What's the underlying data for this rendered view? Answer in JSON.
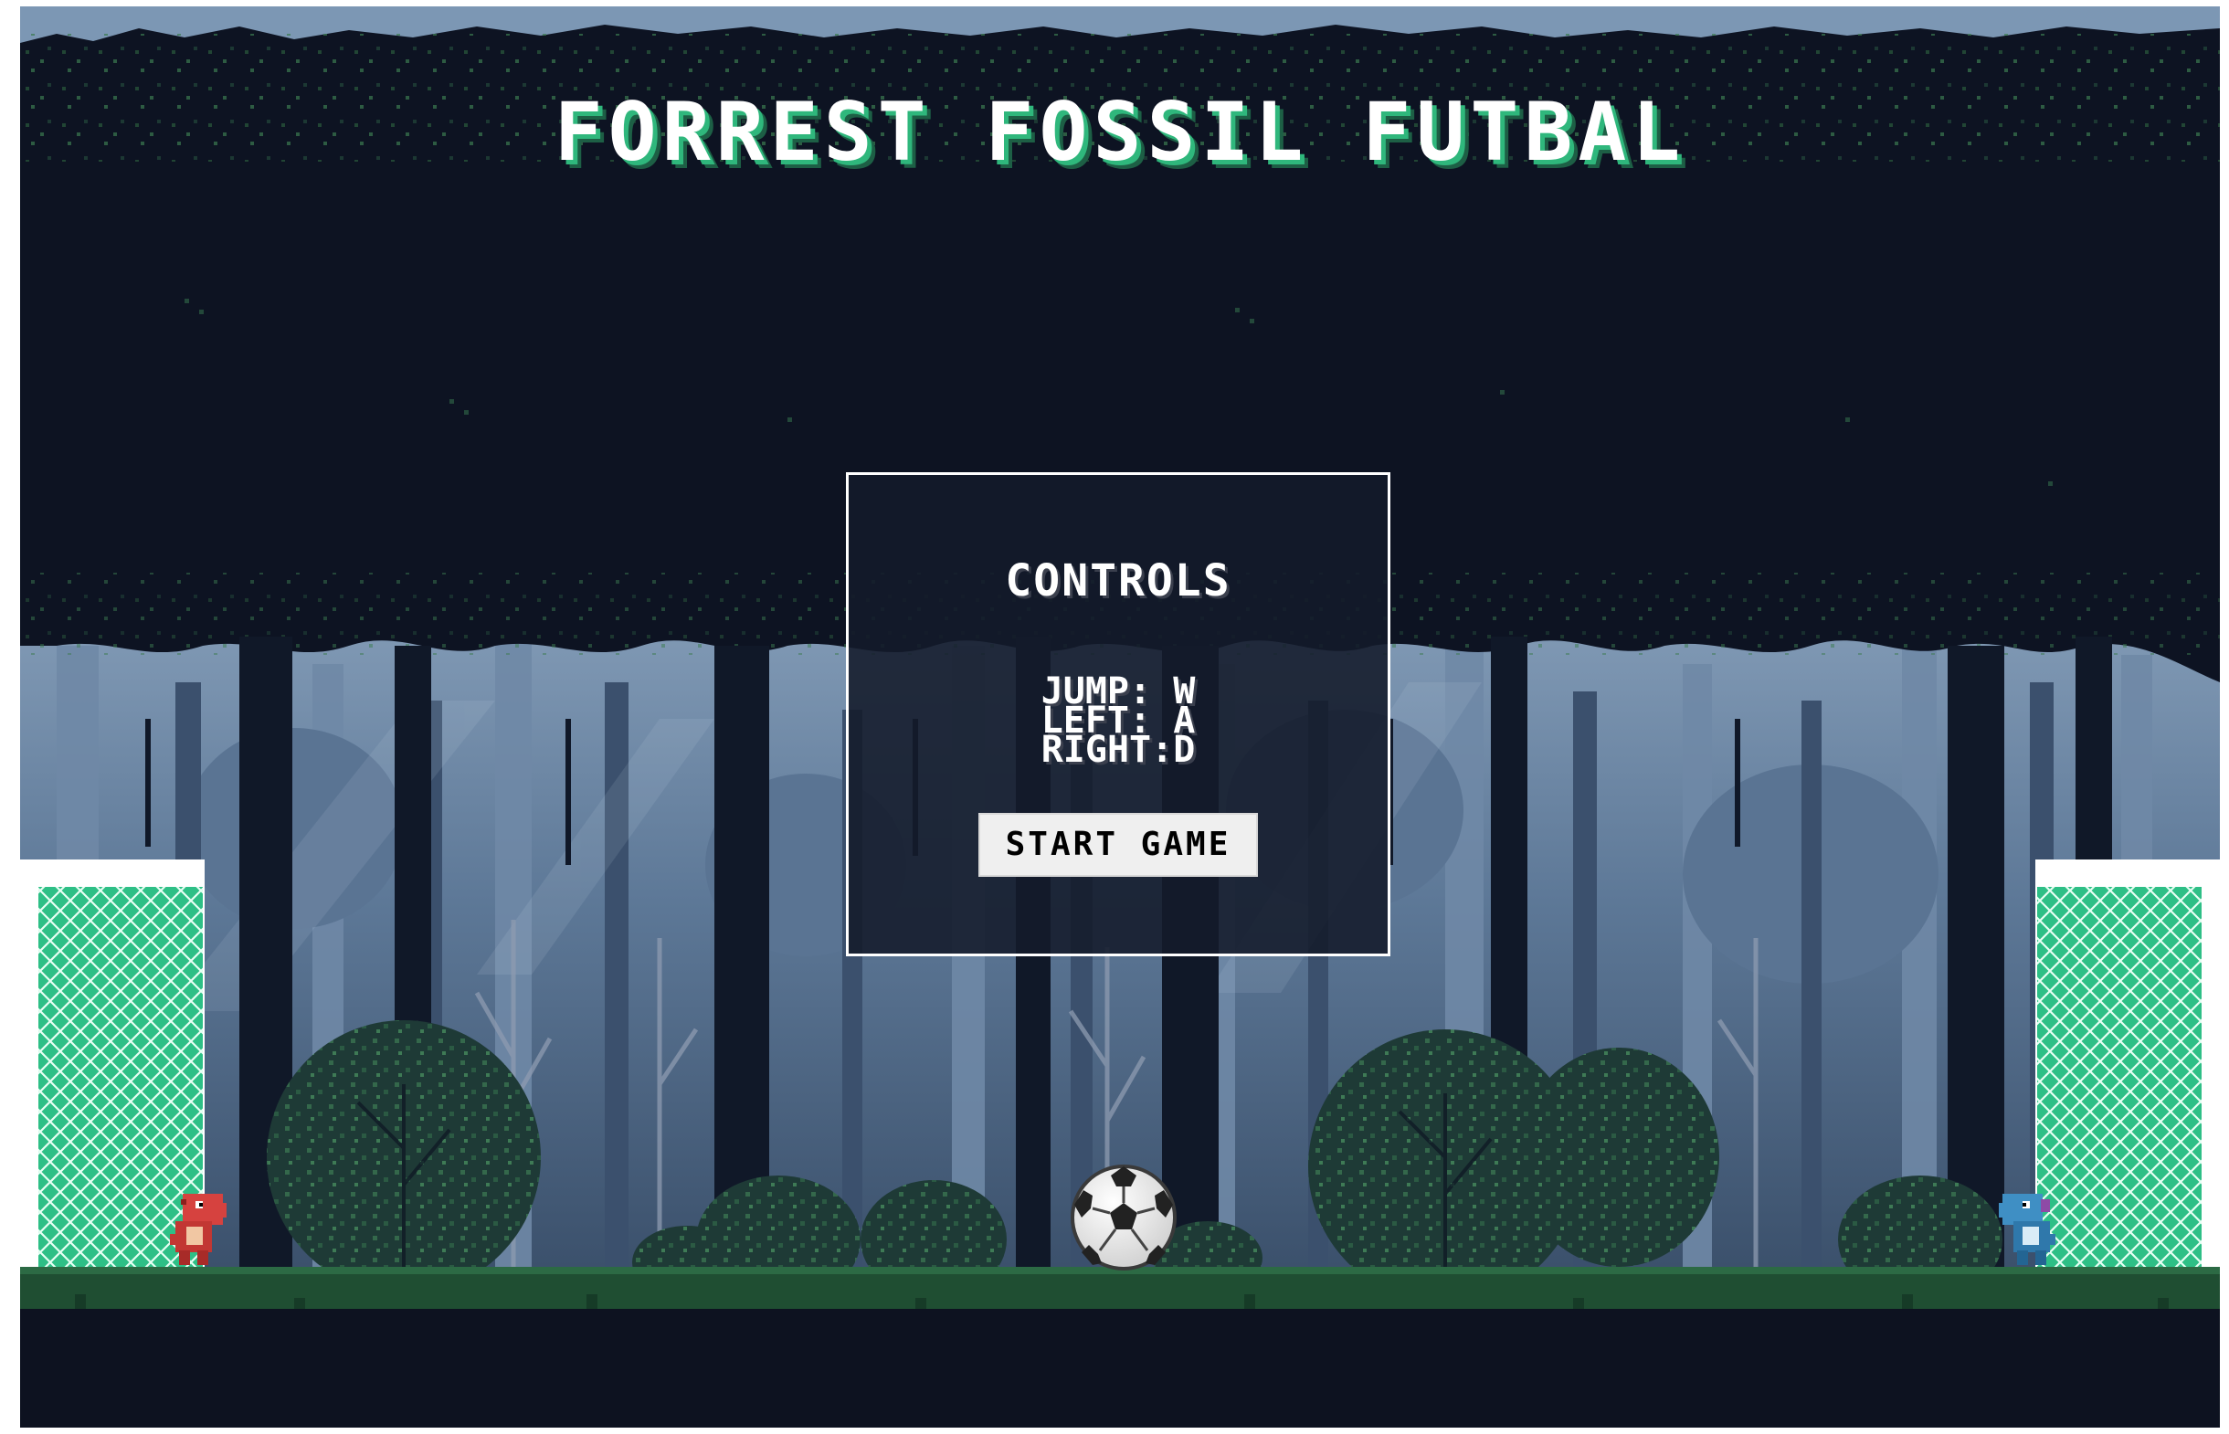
{
  "game": {
    "title": "FORREST FOSSIL FUTBAL",
    "controls_panel": {
      "heading": "CONTROLS",
      "rows": [
        {
          "label": "JUMP:",
          "key": "W"
        },
        {
          "label": "LEFT:",
          "key": "A"
        },
        {
          "label": "RIGHT:",
          "key": "D"
        }
      ],
      "start_button_label": "START GAME"
    },
    "players": [
      {
        "name": "red-dino",
        "color": "#d6423f",
        "side": "left"
      },
      {
        "name": "blue-dino",
        "color": "#3f8fc4",
        "side": "right"
      }
    ],
    "ball": {
      "icon": "soccer-ball-icon"
    },
    "goals": [
      {
        "side": "left",
        "net_color": "#2ebf86"
      },
      {
        "side": "right",
        "net_color": "#2ebf86"
      }
    ]
  },
  "colors": {
    "sky": "#7c97b4",
    "canopy": "#0d1322",
    "forest_mid": "#4d6684",
    "grass": "#1f4e32",
    "ground": "#0d1220",
    "title_shadow": "#2fb77c"
  }
}
